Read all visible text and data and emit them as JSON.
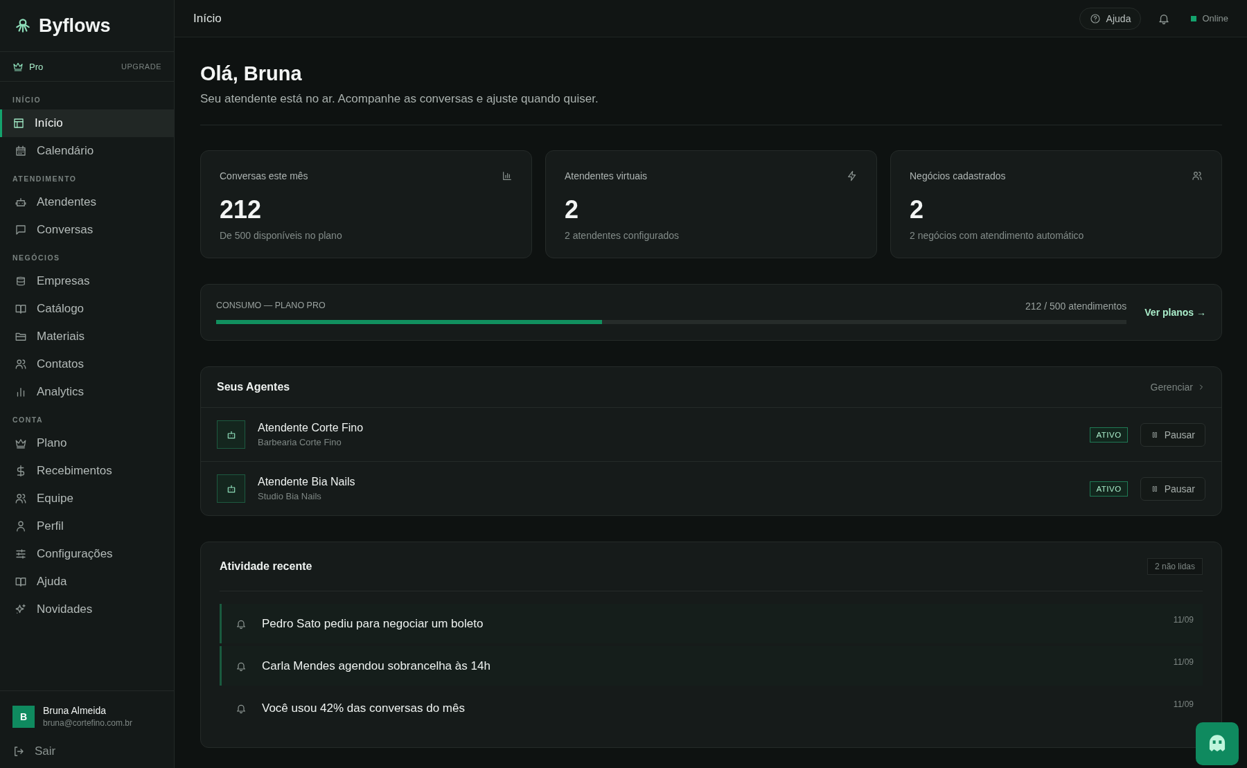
{
  "brand": {
    "name": "Byflows"
  },
  "plan": {
    "label": "Pro",
    "action": "UPGRADE"
  },
  "sidebar": {
    "sections": [
      {
        "title": "INÍCIO",
        "items": [
          {
            "label": "Início",
            "selected": true
          },
          {
            "label": "Calendário",
            "selected": false
          }
        ]
      },
      {
        "title": "ATENDIMENTO",
        "items": [
          {
            "label": "Atendentes",
            "selected": false
          },
          {
            "label": "Conversas",
            "selected": false
          }
        ]
      },
      {
        "title": "NEGÓCIOS",
        "items": [
          {
            "label": "Empresas",
            "selected": false
          },
          {
            "label": "Catálogo",
            "selected": false
          },
          {
            "label": "Materiais",
            "selected": false
          },
          {
            "label": "Contatos",
            "selected": false
          },
          {
            "label": "Analytics",
            "selected": false
          }
        ]
      },
      {
        "title": "CONTA",
        "items": [
          {
            "label": "Plano",
            "selected": false
          },
          {
            "label": "Recebimentos",
            "selected": false
          },
          {
            "label": "Equipe",
            "selected": false
          },
          {
            "label": "Perfil",
            "selected": false
          },
          {
            "label": "Configurações",
            "selected": false
          },
          {
            "label": "Ajuda",
            "selected": false
          },
          {
            "label": "Novidades",
            "selected": false
          }
        ]
      }
    ]
  },
  "user": {
    "initial": "B",
    "name": "Bruna Almeida",
    "email": "bruna@cortefino.com.br",
    "logout": "Sair"
  },
  "header": {
    "breadcrumb": "Início",
    "help": "Ajuda",
    "status": {
      "label": "Online",
      "online": true
    }
  },
  "greeting": {
    "title": "Olá, Bruna",
    "subtitle": "Seu atendente está no ar. Acompanhe as conversas e ajuste quando quiser."
  },
  "stats": [
    {
      "label": "Conversas este mês",
      "value": "212",
      "note": "De 500 disponíveis no plano"
    },
    {
      "label": "Atendentes virtuais",
      "value": "2",
      "note": "2 atendentes configurados"
    },
    {
      "label": "Negócios cadastrados",
      "value": "2",
      "note": "2 negócios com atendimento automático"
    }
  ],
  "usage": {
    "title": "CONSUMO — PLANO PRO",
    "reading": "212 / 500 atendimentos",
    "level": 0.424,
    "link": "Ver planos →"
  },
  "agents": {
    "title": "Seus Agentes",
    "manage": "Gerenciar",
    "items": [
      {
        "name": "Atendente Corte Fino",
        "business": "Barbearia Corte Fino",
        "status": "ATIVO",
        "action": "Pausar"
      },
      {
        "name": "Atendente Bia Nails",
        "business": "Studio Bia Nails",
        "status": "ATIVO",
        "action": "Pausar"
      }
    ]
  },
  "activity": {
    "title": "Atividade recente",
    "badge": "2 não lidas",
    "items": [
      {
        "text": "Pedro Sato pediu para negociar um boleto",
        "date": "11/09",
        "unread": true
      },
      {
        "text": "Carla Mendes agendou sobrancelha às 14h",
        "date": "11/09",
        "unread": true
      },
      {
        "text": "Você usou 42% das conversas do mês",
        "date": "11/09",
        "unread": false
      }
    ]
  }
}
